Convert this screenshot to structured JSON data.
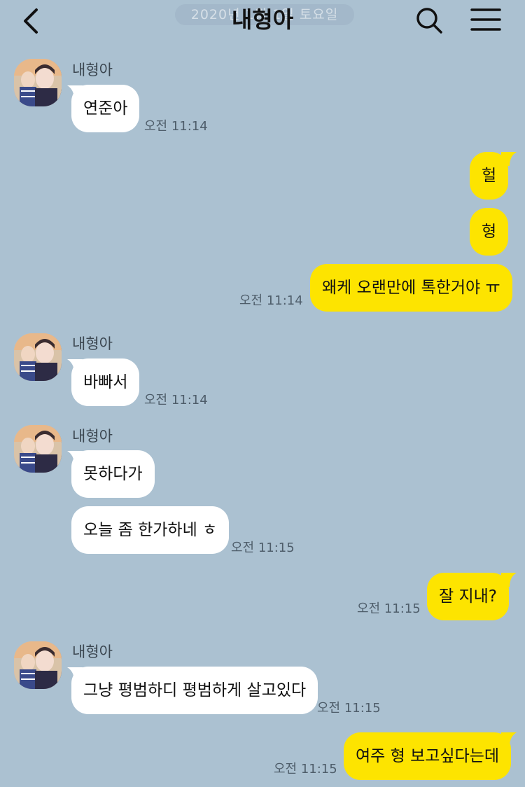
{
  "header": {
    "title": "내형아",
    "date_divider": "2020년 1월 1일 토요일"
  },
  "colors": {
    "background": "#abc1d1",
    "bubble_out": "#fde400",
    "bubble_in": "#ffffff"
  },
  "messages": [
    {
      "sender": "내형아",
      "text": "연준아",
      "time": "오전 11:14"
    },
    {
      "text": "헐"
    },
    {
      "text": "형"
    },
    {
      "text": "왜케 오랜만에 톡한거야 ㅠ",
      "time": "오전 11:14"
    },
    {
      "sender": "내형아",
      "text": "바빠서",
      "time": "오전 11:14"
    },
    {
      "sender": "내형아",
      "text": "못하다가"
    },
    {
      "text": "오늘 좀 한가하네 ㅎ",
      "time": "오전 11:15"
    },
    {
      "text": "잘 지내?",
      "time": "오전 11:15"
    },
    {
      "sender": "내형아",
      "text": "그냥 평범하디 평범하게 살고있다",
      "time": "오전 11:15"
    },
    {
      "text": "여주 형 보고싶다는데",
      "time": "오전 11:15"
    }
  ]
}
